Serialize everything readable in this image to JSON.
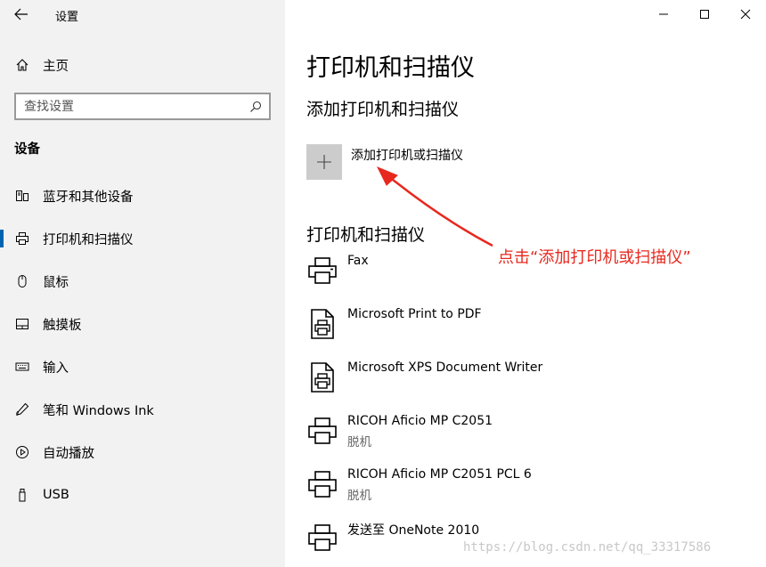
{
  "window": {
    "title": "设置",
    "controls": {
      "minimize": "minimize",
      "maximize": "maximize",
      "close": "close"
    }
  },
  "sidebar": {
    "home_label": "主页",
    "search_placeholder": "查找设置",
    "section_title": "设备",
    "items": [
      {
        "label": "蓝牙和其他设备",
        "icon": "bluetooth-devices-icon",
        "active": false
      },
      {
        "label": "打印机和扫描仪",
        "icon": "printer-icon",
        "active": true
      },
      {
        "label": "鼠标",
        "icon": "mouse-icon",
        "active": false
      },
      {
        "label": "触摸板",
        "icon": "touchpad-icon",
        "active": false
      },
      {
        "label": "输入",
        "icon": "keyboard-icon",
        "active": false
      },
      {
        "label": "笔和 Windows Ink",
        "icon": "pen-icon",
        "active": false
      },
      {
        "label": "自动播放",
        "icon": "autoplay-icon",
        "active": false
      },
      {
        "label": "USB",
        "icon": "usb-icon",
        "active": false
      }
    ]
  },
  "main": {
    "page_title": "打印机和扫描仪",
    "add_section_title": "添加打印机和扫描仪",
    "add_button_label": "添加打印机或扫描仪",
    "list_section_title": "打印机和扫描仪",
    "printers": [
      {
        "name": "Fax",
        "status": "",
        "icon": "fax-printer-icon"
      },
      {
        "name": "Microsoft Print to PDF",
        "status": "",
        "icon": "document-printer-icon"
      },
      {
        "name": "Microsoft XPS Document Writer",
        "status": "",
        "icon": "document-printer-icon"
      },
      {
        "name": "RICOH Aficio MP C2051",
        "status": "脱机",
        "icon": "printer-icon"
      },
      {
        "name": "RICOH Aficio MP C2051 PCL 6",
        "status": "脱机",
        "icon": "printer-icon"
      },
      {
        "name": "发送至 OneNote 2010",
        "status": "",
        "icon": "printer-icon"
      }
    ]
  },
  "annotation": {
    "text": "点击“添加打印机或扫描仪”",
    "color": "#e8281e"
  },
  "watermark": "https://blog.csdn.net/qq_33317586",
  "colors": {
    "sidebar_bg": "#f2f2f2",
    "accent": "#0063b1",
    "add_button_bg": "#cccccc"
  }
}
